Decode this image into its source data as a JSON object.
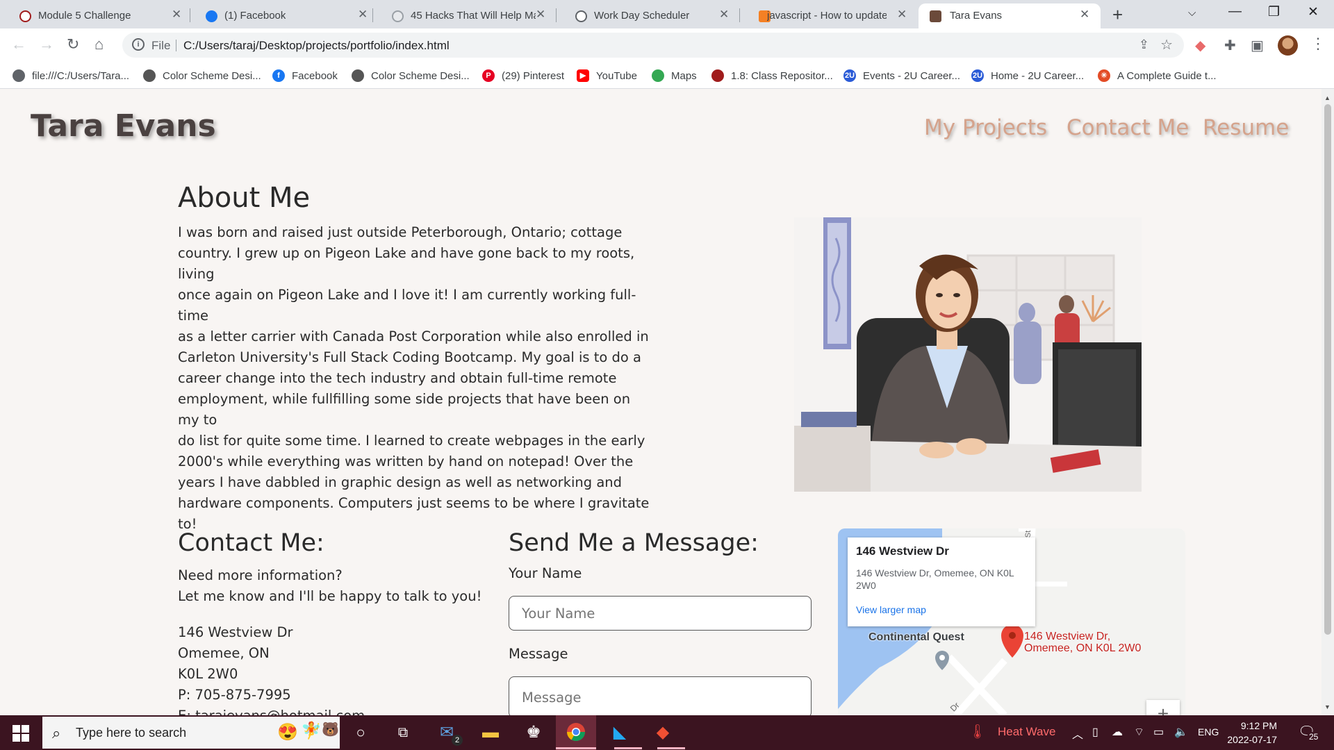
{
  "browser": {
    "tabs": [
      {
        "title": "Module 5 Challenge",
        "active": false
      },
      {
        "title": "(1) Facebook",
        "active": false
      },
      {
        "title": "45 Hacks That Will Help Ma",
        "active": false
      },
      {
        "title": "Work Day Scheduler",
        "active": false
      },
      {
        "title": "javascript - How to update",
        "active": false
      },
      {
        "title": "Tara Evans",
        "active": true
      }
    ],
    "address": {
      "scheme": "File",
      "url": "C:/Users/taraj/Desktop/projects/portfolio/index.html"
    },
    "bookmarks": [
      "file:///C:/Users/Tara...",
      "Color Scheme Desi...",
      "Facebook",
      "Color Scheme Desi...",
      "(29) Pinterest",
      "YouTube",
      "Maps",
      "1.8: Class Repositor...",
      "Events - 2U Career...",
      "Home - 2U Career...",
      "A Complete Guide t..."
    ]
  },
  "page": {
    "site_name": "Tara Evans",
    "nav": [
      "My Projects",
      "Contact Me",
      "Resume"
    ],
    "about": {
      "title": "About Me",
      "lines": [
        "I was born and raised just outside Peterborough, Ontario; cottage",
        "country. I grew up on Pigeon Lake and have gone back to my roots, living",
        "once again on Pigeon Lake and I love it! I am currently working full-time",
        "as a letter carrier with Canada Post Corporation while also enrolled in",
        "Carleton University's Full Stack Coding Bootcamp. My goal is to do a",
        "career change into the tech industry and obtain full-time remote",
        "employment, while fullfilling some side projects that have been on my to",
        "do list for quite some time. I learned to create webpages in the early",
        "2000's while everything was written by hand on notepad! Over the",
        "years I have dabbled in graphic design as well as networking and",
        "hardware components. Computers just seems to be where I gravitate",
        "to!"
      ]
    },
    "contact": {
      "title": "Contact Me:",
      "intro1": "Need more information?",
      "intro2": "Let me know and I'll be happy to talk to you!",
      "address1": "146 Westview Dr",
      "address2": "Omemee, ON",
      "postal": "K0L 2W0",
      "phone": "P: 705-875-7995",
      "email": "E: tarajevans@hotmail.com"
    },
    "message": {
      "title": "Send Me a Message:",
      "name_label": "Your Name",
      "name_placeholder": "Your Name",
      "message_label": "Message",
      "message_placeholder": "Message"
    },
    "map": {
      "card_title": "146 Westview Dr",
      "card_address": "146 Westview Dr, Omemee, ON K0L 2W0",
      "card_link": "View larger map",
      "place_label": "Continental Quest",
      "marker_line1": "146 Westview Dr,",
      "marker_line2": "Omemee, ON K0L 2W0",
      "road_label_1": "Dr",
      "road_label_2": "St",
      "zoom_in": "+"
    }
  },
  "taskbar": {
    "search_placeholder": "Type here to search",
    "mail_badge": "2",
    "weather": "Heat Wave",
    "language": "ENG",
    "time": "9:12 PM",
    "date": "2022-07-17",
    "notifications": "25"
  },
  "colors": {
    "page_bg": "#f8f5f3",
    "nav_link": "#d5a38c",
    "site_name": "#4a4140",
    "taskbar": "#3b1420"
  }
}
